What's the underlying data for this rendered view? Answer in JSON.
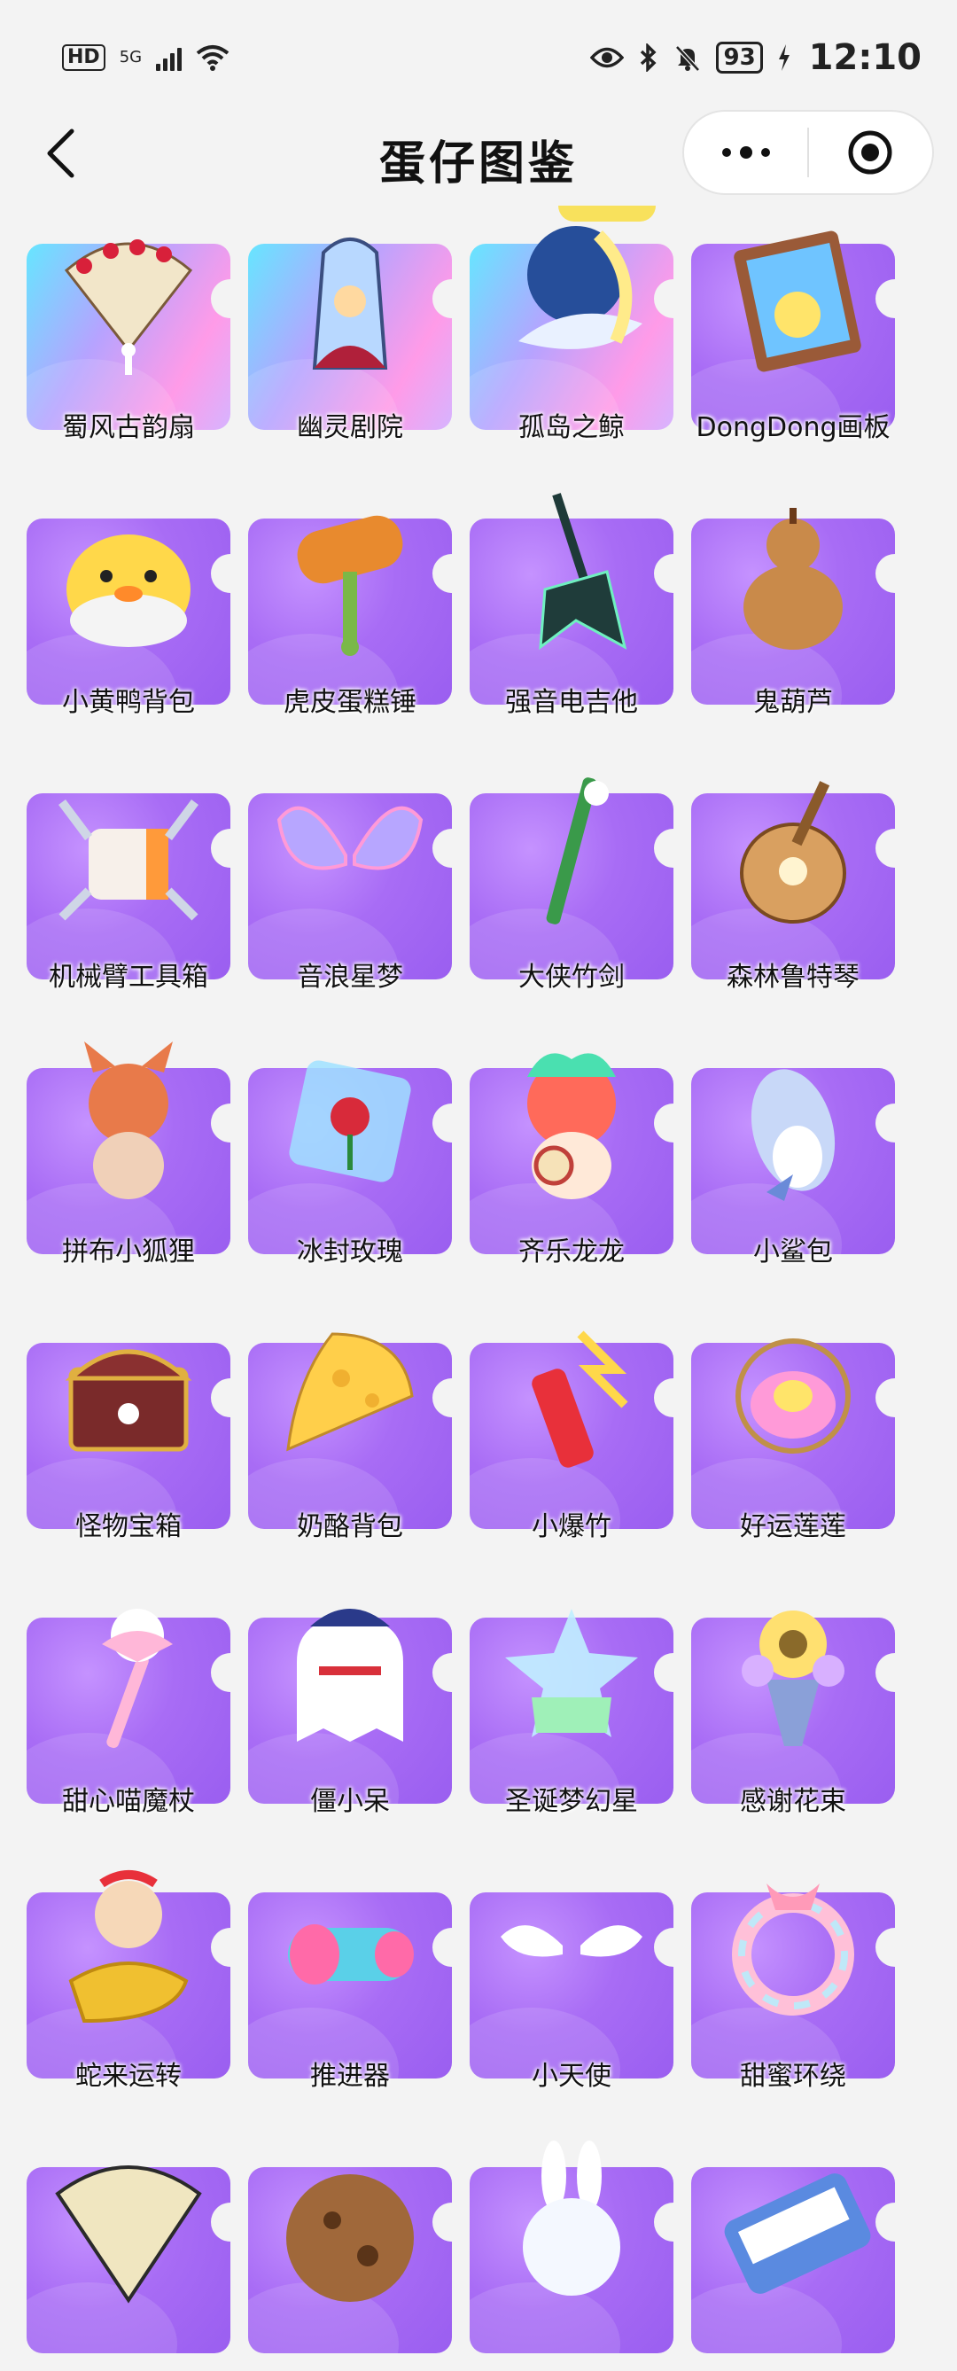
{
  "status_bar": {
    "hd": "HD",
    "network": "5G",
    "battery": "93",
    "time": "12:10"
  },
  "nav": {
    "title": "蛋仔图鉴"
  },
  "colors": {
    "card_purple": "#a86cf5",
    "card_rainbow_start": "#66e6ff",
    "card_rainbow_end": "#ff9be8",
    "pill_yellow": "#f8e15c"
  },
  "items": [
    {
      "name": "蜀风古韵扇",
      "icon": "folding-fan-icon",
      "style": "rainbow"
    },
    {
      "name": "幽灵剧院",
      "icon": "ghost-theater-icon",
      "style": "rainbow"
    },
    {
      "name": "孤岛之鲸",
      "icon": "whale-moon-icon",
      "style": "rainbow"
    },
    {
      "name": "DongDong画板",
      "icon": "drawing-board-icon",
      "style": "purple"
    },
    {
      "name": "小黄鸭背包",
      "icon": "duck-backpack-icon",
      "style": "purple"
    },
    {
      "name": "虎皮蛋糕锤",
      "icon": "cake-hammer-icon",
      "style": "purple"
    },
    {
      "name": "强音电吉他",
      "icon": "electric-guitar-icon",
      "style": "purple"
    },
    {
      "name": "鬼葫芦",
      "icon": "gourd-icon",
      "style": "purple"
    },
    {
      "name": "机械臂工具箱",
      "icon": "toolbox-icon",
      "style": "purple"
    },
    {
      "name": "音浪星梦",
      "icon": "wings-icon",
      "style": "purple"
    },
    {
      "name": "大侠竹剑",
      "icon": "bamboo-sword-icon",
      "style": "purple"
    },
    {
      "name": "森林鲁特琴",
      "icon": "lute-icon",
      "style": "purple"
    },
    {
      "name": "拼布小狐狸",
      "icon": "fox-icon",
      "style": "purple"
    },
    {
      "name": "冰封玫瑰",
      "icon": "ice-rose-icon",
      "style": "purple"
    },
    {
      "name": "齐乐龙龙",
      "icon": "dragon-icon",
      "style": "purple"
    },
    {
      "name": "小鲨包",
      "icon": "shark-bag-icon",
      "style": "purple"
    },
    {
      "name": "怪物宝箱",
      "icon": "treasure-chest-icon",
      "style": "purple"
    },
    {
      "name": "奶酪背包",
      "icon": "cheese-bag-icon",
      "style": "purple"
    },
    {
      "name": "小爆竹",
      "icon": "firecracker-icon",
      "style": "purple"
    },
    {
      "name": "好运莲莲",
      "icon": "lotus-icon",
      "style": "purple"
    },
    {
      "name": "甜心喵魔杖",
      "icon": "magic-wand-icon",
      "style": "purple"
    },
    {
      "name": "僵小呆",
      "icon": "ghost-icon",
      "style": "purple"
    },
    {
      "name": "圣诞梦幻星",
      "icon": "star-bottle-icon",
      "style": "purple"
    },
    {
      "name": "感谢花束",
      "icon": "bouquet-icon",
      "style": "purple"
    },
    {
      "name": "蛇来运转",
      "icon": "gold-ingot-icon",
      "style": "purple"
    },
    {
      "name": "推进器",
      "icon": "thruster-icon",
      "style": "purple"
    },
    {
      "name": "小天使",
      "icon": "angel-wings-icon",
      "style": "purple"
    },
    {
      "name": "甜蜜环绕",
      "icon": "ribbon-wreath-icon",
      "style": "purple"
    },
    {
      "name": "",
      "icon": "paper-fan-icon",
      "style": "purple"
    },
    {
      "name": "",
      "icon": "cookie-icon",
      "style": "purple"
    },
    {
      "name": "",
      "icon": "bunny-icon",
      "style": "purple"
    },
    {
      "name": "",
      "icon": "keyboard-icon",
      "style": "purple"
    }
  ]
}
